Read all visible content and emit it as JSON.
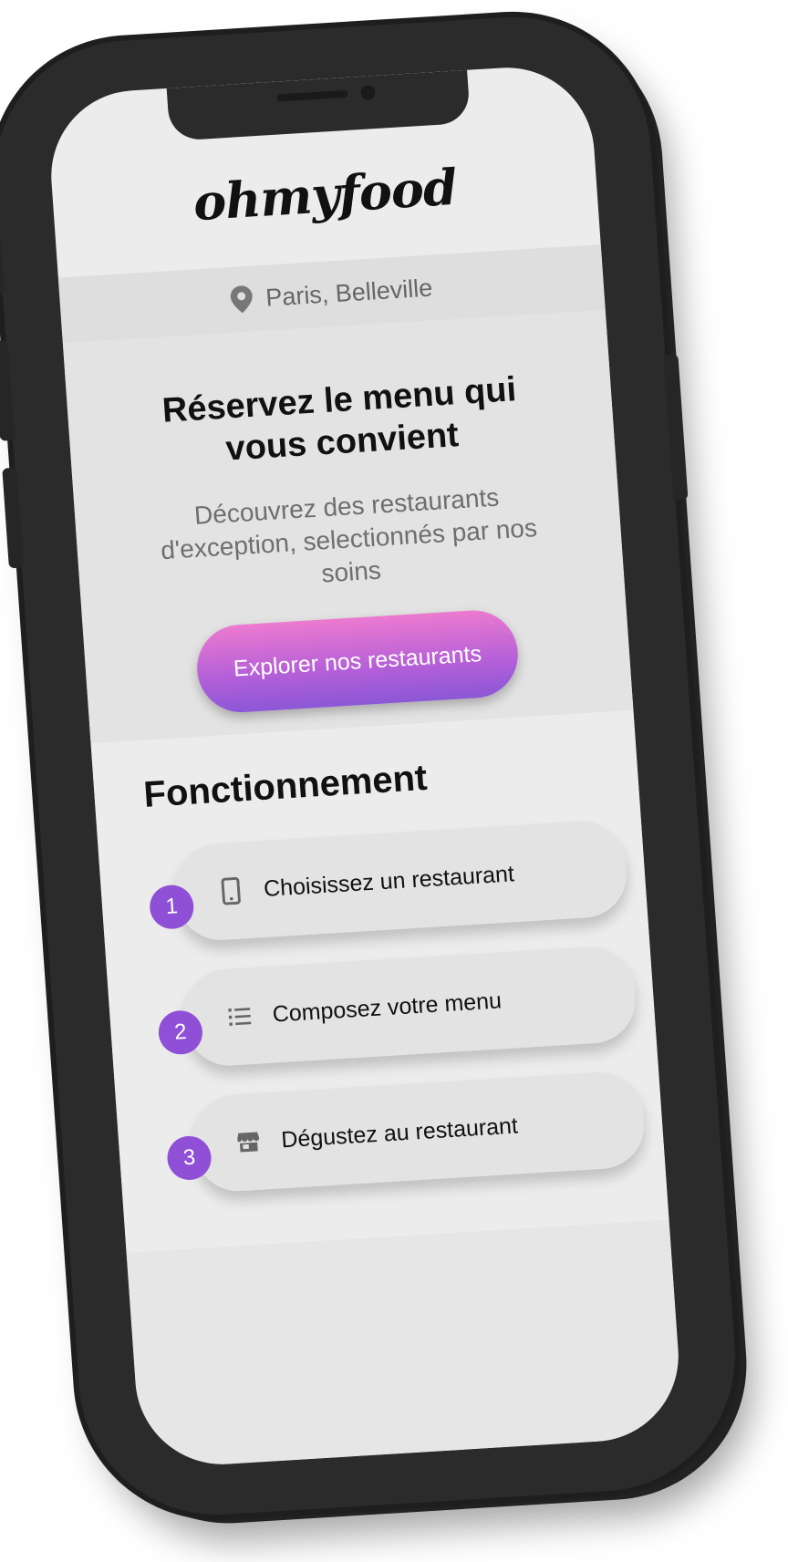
{
  "app": {
    "logo": "ohmyfood"
  },
  "location": {
    "text": "Paris, Belleville",
    "icon": "map-pin-icon"
  },
  "hero": {
    "title": "Réservez le menu qui vous convient",
    "subtitle": "Découvrez des restaurants d'exception, selectionnés par nos soins",
    "cta_label": "Explorer nos restaurants"
  },
  "how": {
    "title": "Fonctionnement",
    "steps": [
      {
        "number": "1",
        "label": "Choisissez un restaurant",
        "icon": "smartphone-icon"
      },
      {
        "number": "2",
        "label": "Composez votre menu",
        "icon": "list-icon"
      },
      {
        "number": "3",
        "label": "Dégustez au restaurant",
        "icon": "store-icon"
      }
    ]
  },
  "colors": {
    "accent": "#8f4fd6",
    "cta_top": "#ec7ad0",
    "cta_bottom": "#8c57d6",
    "phone_frame": "#2b2b2b",
    "screen_bg": "#ececec"
  }
}
